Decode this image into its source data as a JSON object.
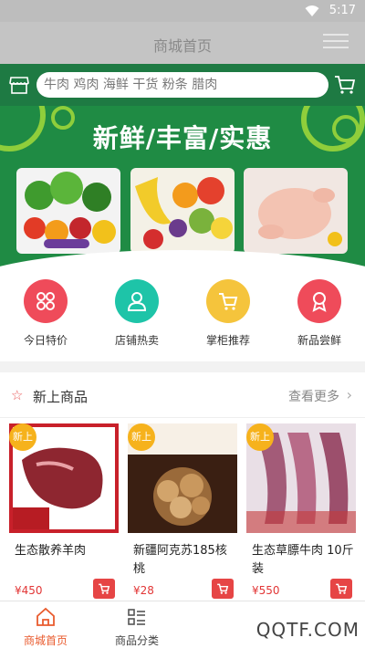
{
  "status_bar": {
    "time": "5:17",
    "wifi_icon": "wifi-icon"
  },
  "title_bar": {
    "title": "商城首页",
    "menu_icon": "menu-icon"
  },
  "search": {
    "placeholder": "牛肉 鸡肉 海鲜 干货 粉条 腊肉",
    "store_icon": "store-icon",
    "cart_icon": "cart-icon"
  },
  "banner": {
    "slogan": "新鲜/丰富/实惠",
    "photos": [
      "vegetables",
      "fruits",
      "chicken"
    ]
  },
  "categories": [
    {
      "label": "今日特价",
      "color": "#ef4b5a",
      "icon": "grid-icon"
    },
    {
      "label": "店铺热卖",
      "color": "#1ec4a8",
      "icon": "user-icon"
    },
    {
      "label": "掌柜推荐",
      "color": "#f5c43c",
      "icon": "cart-icon"
    },
    {
      "label": "新品尝鲜",
      "color": "#ef4b5a",
      "icon": "award-icon"
    }
  ],
  "new_products": {
    "title": "新上商品",
    "more_label": "查看更多",
    "items": [
      {
        "badge": "新上",
        "name": "生态散养羊肉",
        "price": "¥450"
      },
      {
        "badge": "新上",
        "name": "新疆阿克苏185核桃",
        "price": "¥28"
      },
      {
        "badge": "新上",
        "name": "生态草膘牛肉 10斤装",
        "price": "¥550"
      }
    ]
  },
  "tabbar": {
    "items": [
      {
        "label": "商城首页",
        "active": true
      },
      {
        "label": "商品分类",
        "active": false
      }
    ]
  },
  "watermark": "QQTF.COM",
  "colors": {
    "brand_green": "#1e7a43",
    "accent_red": "#e23636",
    "badge_yellow": "#f6b21c"
  }
}
